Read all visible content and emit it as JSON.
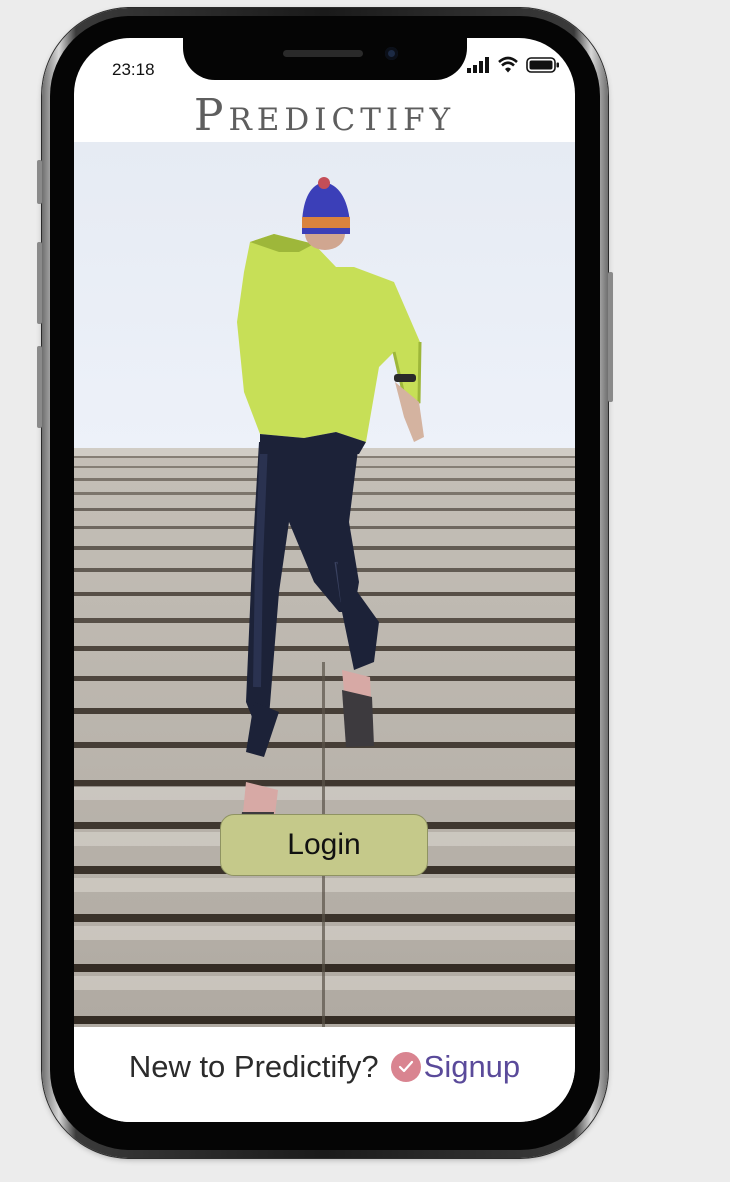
{
  "status_bar": {
    "time": "23:18"
  },
  "app": {
    "title": "Predictify"
  },
  "hero": {
    "image": "runner-on-stairs-photo"
  },
  "actions": {
    "login_label": "Login"
  },
  "footer": {
    "prompt": "New to Predictify?",
    "signup_label": "Signup"
  },
  "icons": {
    "signal": "signal-bars-icon",
    "wifi": "wifi-icon",
    "battery": "battery-icon",
    "checkmark": "checkmark-icon"
  },
  "colors": {
    "login_button": "#c5c98a",
    "signup_link": "#5a4a9a",
    "check_badge": "#d98490",
    "title": "#5e5e5e"
  }
}
